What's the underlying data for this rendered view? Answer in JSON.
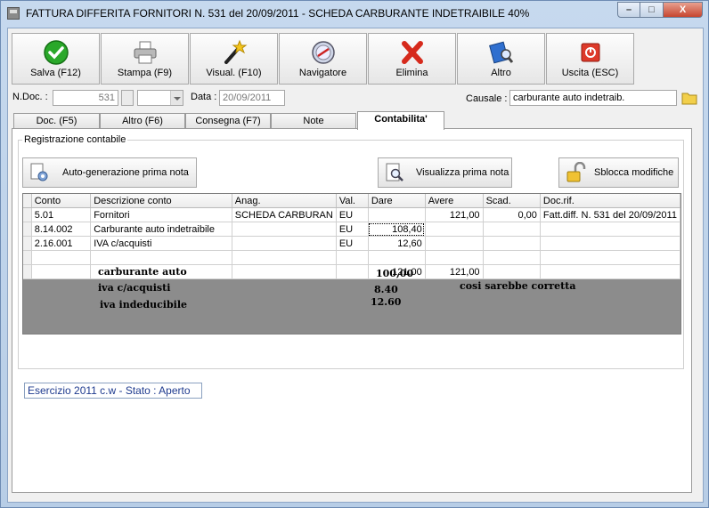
{
  "window": {
    "title": "FATTURA DIFFERITA FORNITORI N. 531  del 20/09/2011 - SCHEDA CARBURANTE  INDETRAIBILE 40%",
    "minimize_glyph": "–",
    "maximize_glyph": "□",
    "close_glyph": "X"
  },
  "toolbar": {
    "save_label": "Salva (F12)",
    "print_label": "Stampa (F9)",
    "view_label": "Visual. (F10)",
    "navigator_label": "Navigatore",
    "delete_label": "Elimina",
    "other_label": "Altro",
    "exit_label": "Uscita (ESC)"
  },
  "header": {
    "ndoc_label": "N.Doc. :",
    "ndoc_value": "531",
    "data_label": "Data :",
    "data_value": "20/09/2011",
    "causale_label": "Causale :",
    "causale_value": "carburante auto indetraib."
  },
  "tabs": [
    "Doc. (F5)",
    "Altro (F6)",
    "Consegna (F7)",
    "Note",
    "Contabilita'"
  ],
  "group": {
    "title": "Registrazione contabile",
    "autogen_label": "Auto-generazione prima nota",
    "view_label": "Visualizza prima nota",
    "unlock_label": "Sblocca modifiche"
  },
  "grid": {
    "columns": [
      "Conto",
      "Descrizione conto",
      "Anag.",
      "Val.",
      "Dare",
      "Avere",
      "Scad.",
      "Doc.rif."
    ],
    "rows": [
      [
        "5.01",
        "Fornitori",
        "SCHEDA CARBURAN",
        "EU",
        "",
        "121,00",
        "0,00",
        "Fatt.diff. N. 531 del 20/09/2011"
      ],
      [
        "8.14.002",
        "Carburante auto indetraibile",
        "",
        "EU",
        "108,40",
        "",
        "",
        ""
      ],
      [
        "2.16.001",
        "IVA c/acquisti",
        "",
        "EU",
        "12,60",
        "",
        "",
        ""
      ],
      [
        "",
        "",
        "",
        "",
        "",
        "",
        "",
        ""
      ]
    ],
    "totals": [
      "",
      "",
      "",
      "",
      "121,00",
      "121,00",
      "",
      ""
    ]
  },
  "notes": {
    "l1": "carburante auto",
    "v1": "100,00",
    "l2": "iva c/acquisti",
    "v2": "8.40",
    "l3": "iva indeducibile",
    "v3": "12.60",
    "comment": "cosi sarebbe corretta"
  },
  "status": "Esercizio 2011 c.w - Stato : Aperto"
}
